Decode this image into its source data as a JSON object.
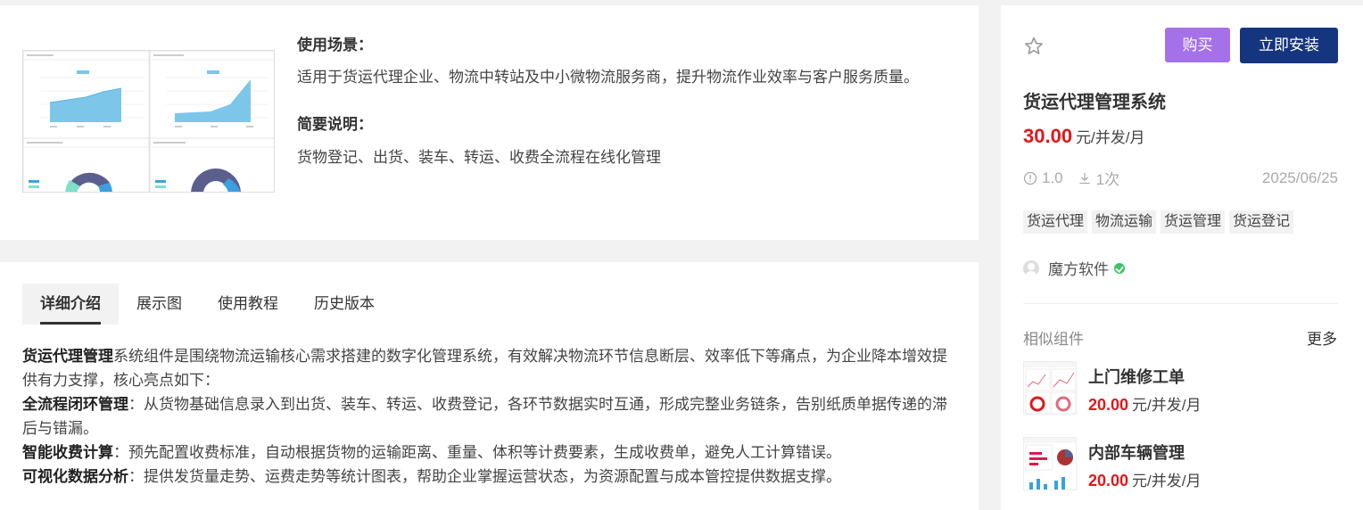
{
  "top_card": {
    "scene_heading": "使用场景：",
    "scene_text": "适用于货运代理企业、物流中转站及中小微物流服务商，提升物流作业效率与客户服务质量。",
    "brief_heading": "简要说明：",
    "brief_text": "货物登记、出货、装车、转运、收费全流程在线化管理"
  },
  "tabs": [
    {
      "label": "详细介绍",
      "active": true
    },
    {
      "label": "展示图",
      "active": false
    },
    {
      "label": "使用教程",
      "active": false
    },
    {
      "label": "历史版本",
      "active": false
    }
  ],
  "description": {
    "intro_bold": "货运代理管理",
    "intro_text": "系统组件是围绕物流运输核心需求搭建的数字化管理系统，有效解决物流环节信息断层、效率低下等痛点，为企业降本增效提供有力支撑，核心亮点如下：",
    "p1_bold": "全流程闭环管理",
    "p1_text": "：从货物基础信息录入到出货、装车、转运、收费登记，各环节数据实时互通，形成完整业务链条，告别纸质单据传递的滞后与错漏。",
    "p2_bold": "智能收费计算",
    "p2_text": "：预先配置收费标准，自动根据货物的运输距离、重量、体积等计费要素，生成收费单，避免人工计算错误。",
    "p3_bold": "可视化数据分析",
    "p3_text": "：提供发货量走势、运费走势等统计图表，帮助企业掌握运营状态，为资源配置与成本管控提供数据支撑。"
  },
  "sidebar": {
    "buy_label": "购买",
    "install_label": "立即安装",
    "title": "货运代理管理系统",
    "price_value": "30.00",
    "price_unit": "元/并发/月",
    "version": "1.0",
    "downloads": "1次",
    "date": "2025/06/25",
    "tags": [
      "货运代理",
      "物流运输",
      "货运管理",
      "货运登记"
    ],
    "vendor": "魔方软件",
    "similar_heading": "相似组件",
    "more_label": "更多",
    "similar": [
      {
        "title": "上门维修工单",
        "price_value": "20.00",
        "price_unit": "元/并发/月"
      },
      {
        "title": "内部车辆管理",
        "price_value": "20.00",
        "price_unit": "元/并发/月"
      }
    ]
  },
  "colors": {
    "buy_button": "#a571e8",
    "install_button": "#15357e",
    "price": "#e0171a",
    "chart_blue": "#7cc6ea",
    "donut_dark": "#5a5f8e",
    "donut_teal": "#7fe0c8"
  }
}
